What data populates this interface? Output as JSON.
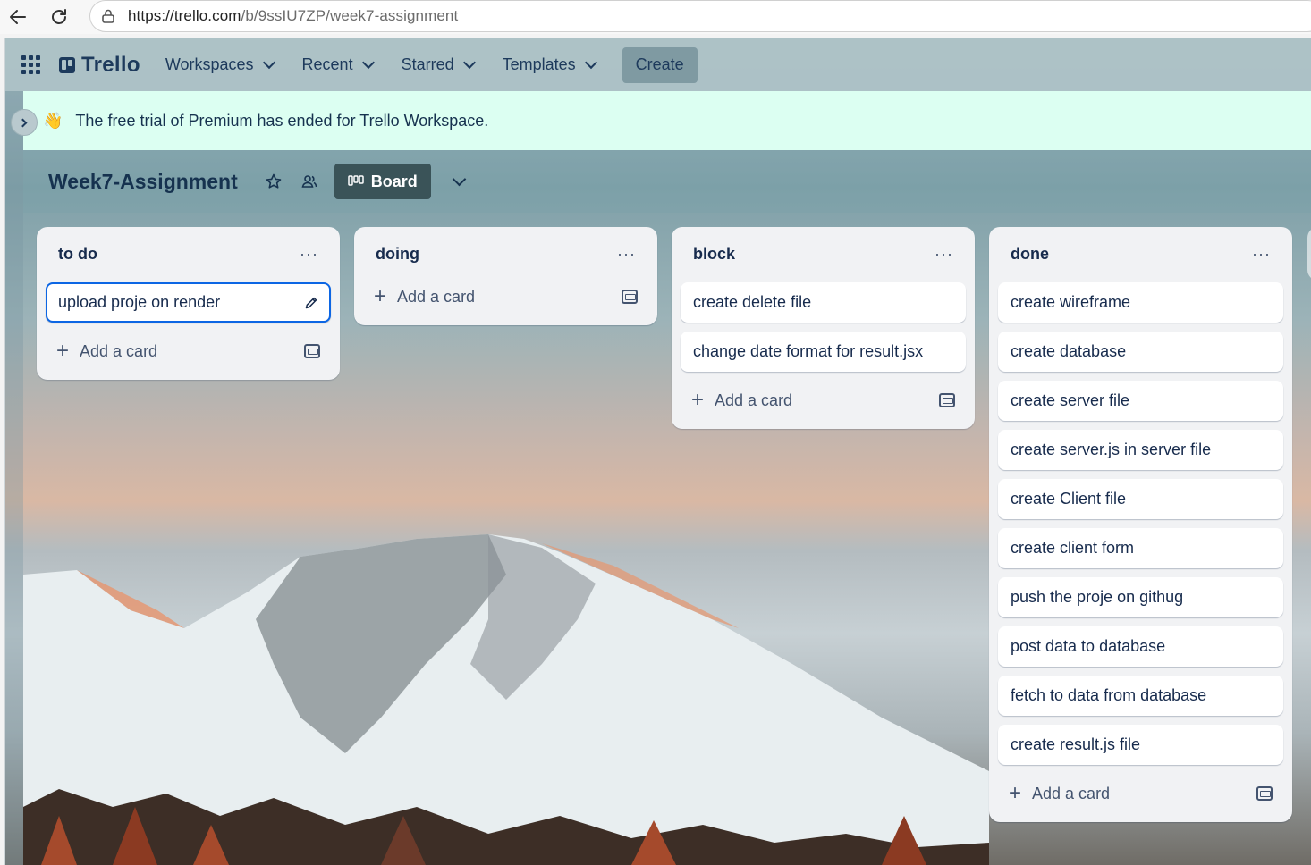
{
  "browser": {
    "url_host": "https://trello.com",
    "url_path": "/b/9ssIU7ZP/week7-assignment"
  },
  "topnav": {
    "logo_text": "Trello",
    "menus": [
      "Workspaces",
      "Recent",
      "Starred",
      "Templates"
    ],
    "create_label": "Create"
  },
  "banner": {
    "emoji": "👋",
    "text": "The free trial of Premium has ended for Trello Workspace."
  },
  "board": {
    "title": "Week7-Assignment",
    "view_label": "Board"
  },
  "lists": [
    {
      "title": "to do",
      "menu": "···",
      "cards": [
        "upload proje on render"
      ],
      "add_label": "Add a card"
    },
    {
      "title": "doing",
      "menu": "···",
      "cards": [],
      "add_label": "Add a card"
    },
    {
      "title": "block",
      "menu": "···",
      "cards": [
        "create delete file",
        "change date format for result.jsx"
      ],
      "add_label": "Add a card"
    },
    {
      "title": "done",
      "menu": "···",
      "cards": [
        "create wireframe",
        "create database",
        "create server file",
        "create server.js in server file",
        "create Client file",
        "create client form",
        "push the proje on githug",
        "post data to database",
        "fetch to data from database",
        "create result.js file"
      ],
      "add_label": "Add a card"
    }
  ],
  "colors": {
    "nav_text": "#1d3a5c",
    "banner_bg": "#dcfff2",
    "list_bg": "#f1f2f4",
    "edit_border": "#0c66e4",
    "board_btn_bg": "#3a5358"
  }
}
